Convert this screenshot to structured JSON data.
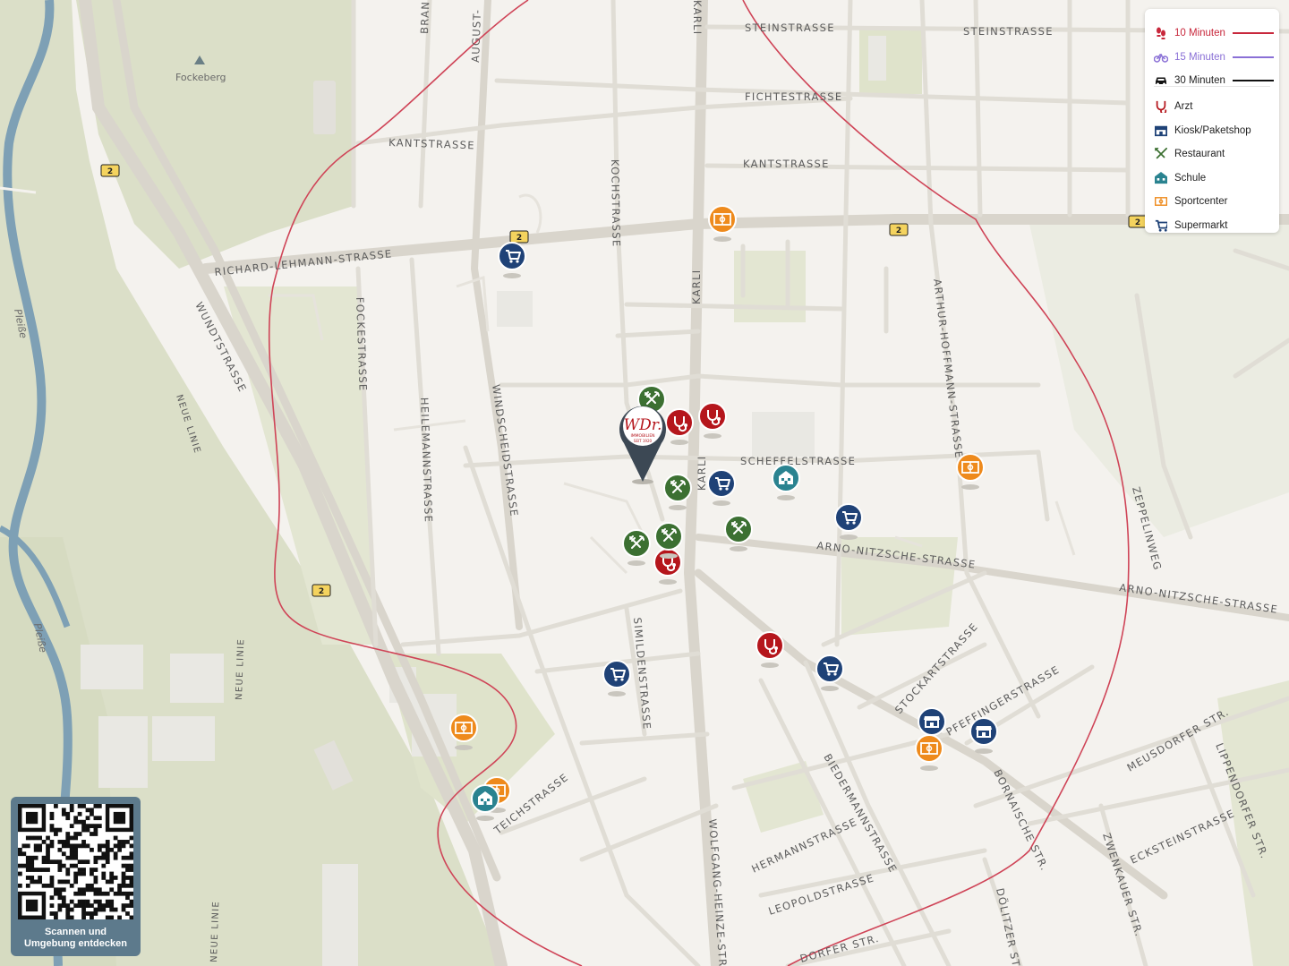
{
  "legend": {
    "travel": [
      {
        "label": "10 Minuten",
        "color": "#c8283c",
        "icon": "walk-icon"
      },
      {
        "label": "15 Minuten",
        "color": "#8a70d6",
        "icon": "bike-icon"
      },
      {
        "label": "30 Minuten",
        "color": "#111111",
        "icon": "car-icon"
      }
    ],
    "categories": [
      {
        "label": "Arzt",
        "color": "#b5161c",
        "icon": "stethoscope-icon"
      },
      {
        "label": "Kiosk/Paketshop",
        "color": "#1f4277",
        "icon": "shop-icon"
      },
      {
        "label": "Restaurant",
        "color": "#3c7032",
        "icon": "cutlery-icon"
      },
      {
        "label": "Schule",
        "color": "#2a8390",
        "icon": "school-icon"
      },
      {
        "label": "Sportcenter",
        "color": "#ee8a1c",
        "icon": "sport-icon"
      },
      {
        "label": "Supermarkt",
        "color": "#1f4277",
        "icon": "cart-icon"
      }
    ]
  },
  "map": {
    "streets": {
      "steinstrasse_1": "STEINSTRASSE",
      "steinstrasse_2": "STEINSTRASSE",
      "fichtestrasse": "FICHTESTRASSE",
      "kantstrasse_1": "KANTSTRASSE",
      "kantstrasse_2": "KANTSTRASSE",
      "richard_lehmann": "RICHARD-LEHMANN-STRASSE",
      "wundtstrasse": "WUNDTSTRASSE",
      "fockestrasse": "FOCKESTRASSE",
      "heilemannstrasse": "HEILEMANNSTRASSE",
      "windscheidstrasse": "WINDSCHEIDSTRASSE",
      "kochstrasse": "KOCHSTRASSE",
      "karli_1": "KARLI",
      "karli_2": "KARLI",
      "karli_3": "KARLI",
      "scheffelstrasse": "SCHEFFELSTRASSE",
      "arno_nitzsche_1": "ARNO-NITZSCHE-STRASSE",
      "arno_nitzsche_2": "ARNO-NITZSCHE-STRASSE",
      "arthur_hoffmann": "ARTHUR-HOFFMANN-STRASSE",
      "zeppelinweg": "ZEPPELINWEG",
      "simildenstrasse": "SIMILDENSTRASSE",
      "stockartstrasse": "STOCKARTSTRASSE",
      "pfeffingerstrasse": "PFEFFINGERSTRASSE",
      "meusdorfer": "MEUSDORFER STR.",
      "lippendorfer": "LIPPENDORFER STR.",
      "bornaische": "BORNAISCHE STR.",
      "zwenkauer": "ZWENKAUER STR.",
      "eckstein": "ECKSTEINSTRASSE",
      "biedermann": "BIEDERMANNSTRASSE",
      "hermann": "HERMANNSTRASSE",
      "leopold": "LEOPOLDSTRASSE",
      "wolfgang_heinze": "WOLFGANG-HEINZE-STR.",
      "teichstrasse": "TEICHSTRASSE",
      "doelitzer": "DÖLITZER STR.",
      "dorfer": "DORFER STR.",
      "neue_linie_1": "NEUE LINIE",
      "neue_linie_2": "NEUE LINIE",
      "neue_linie_3": "NEUE LINIE",
      "august": "AUGUST-",
      "brand": "BRAND",
      "pleisse_1": "Pleiße",
      "pleisse_2": "Pleiße",
      "fockeberg": "Fockeberg"
    },
    "route_badge": "2",
    "pin_logo_main": "WDr.",
    "pin_logo_sub": "IMMOBILIEN",
    "pin_logo_est": "SEIT 1920"
  },
  "qr": {
    "line1": "Scannen und",
    "line2": "Umgebung entdecken"
  }
}
